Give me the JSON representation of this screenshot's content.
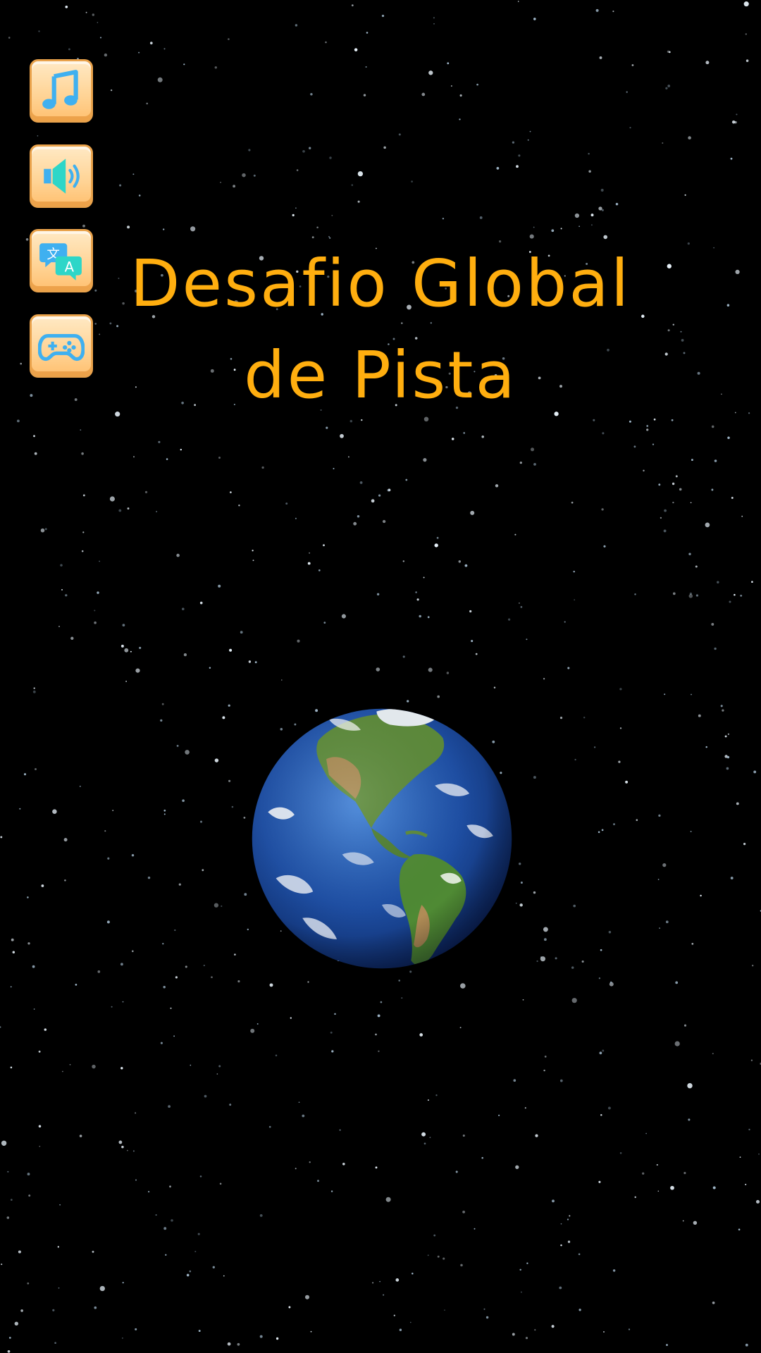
{
  "title": {
    "line1": "Desafio Global",
    "line2": "de Pista"
  },
  "side_menu": {
    "items": [
      {
        "id": "music",
        "icon": "music-note-icon"
      },
      {
        "id": "sound",
        "icon": "speaker-icon"
      },
      {
        "id": "language",
        "icon": "translate-icon"
      },
      {
        "id": "game",
        "icon": "gamepad-icon"
      }
    ]
  },
  "colors": {
    "title": "#ffae0f",
    "button_face": "#ffd394",
    "button_border": "#e9a24b",
    "icon_blue": "#3fb0f0",
    "space": "#000000"
  }
}
